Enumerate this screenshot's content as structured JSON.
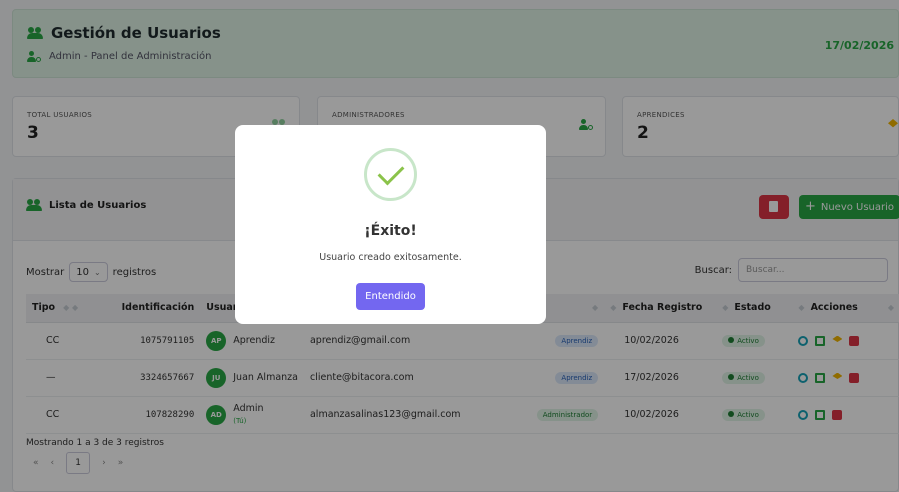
{
  "header": {
    "title": "Gestión de Usuarios",
    "subtitle": "Admin - Panel de Administración",
    "date": "17/02/2026"
  },
  "stats": [
    {
      "label": "TOTAL USUARIOS",
      "value": "3",
      "icon": "users-icon",
      "color": "#28a745"
    },
    {
      "label": "ADMINISTRADORES",
      "value": "",
      "icon": "user-cog-icon",
      "color": "#28a745"
    },
    {
      "label": "APRENDICES",
      "value": "2",
      "icon": "graduation-icon",
      "color": "#f0b400"
    }
  ],
  "list": {
    "title": "Lista de Usuarios",
    "new_button": "Nuevo Usuario",
    "show_label": "Mostrar",
    "page_size": "10",
    "records_label": "registros",
    "search_label": "Buscar:",
    "search_placeholder": "Buscar..."
  },
  "table": {
    "headers": [
      "Tipo",
      "Identificación",
      "Usuario",
      "",
      "",
      "Fecha Registro",
      "Estado",
      "Acciones"
    ],
    "rows": [
      {
        "tipo": "CC",
        "id": "1075791105",
        "avatar": "AP",
        "name": "Aprendiz",
        "you": "",
        "email": "aprendiz@gmail.com",
        "role": "Aprendiz",
        "role_type": "aprendiz",
        "date": "10/02/2026",
        "estado": "Activo"
      },
      {
        "tipo": "—",
        "id": "3324657667",
        "avatar": "JU",
        "name": "Juan Almanza",
        "you": "",
        "email": "cliente@bitacora.com",
        "role": "Aprendiz",
        "role_type": "aprendiz",
        "date": "17/02/2026",
        "estado": "Activo"
      },
      {
        "tipo": "CC",
        "id": "107828290",
        "avatar": "AD",
        "name": "Admin",
        "you": "(Tú)",
        "email": "almanzasalinas123@gmail.com",
        "role": "Administrador",
        "role_type": "admin",
        "date": "10/02/2026",
        "estado": "Activo"
      }
    ]
  },
  "footer": {
    "info": "Mostrando 1 a 3 de 3 registros",
    "first": "«",
    "prev": "‹",
    "current_page": "1",
    "next": "›",
    "last": "»"
  },
  "modal": {
    "title": "¡Éxito!",
    "message": "Usuario creado exitosamente.",
    "button": "Entendido",
    "icon": "check-circle-icon"
  }
}
